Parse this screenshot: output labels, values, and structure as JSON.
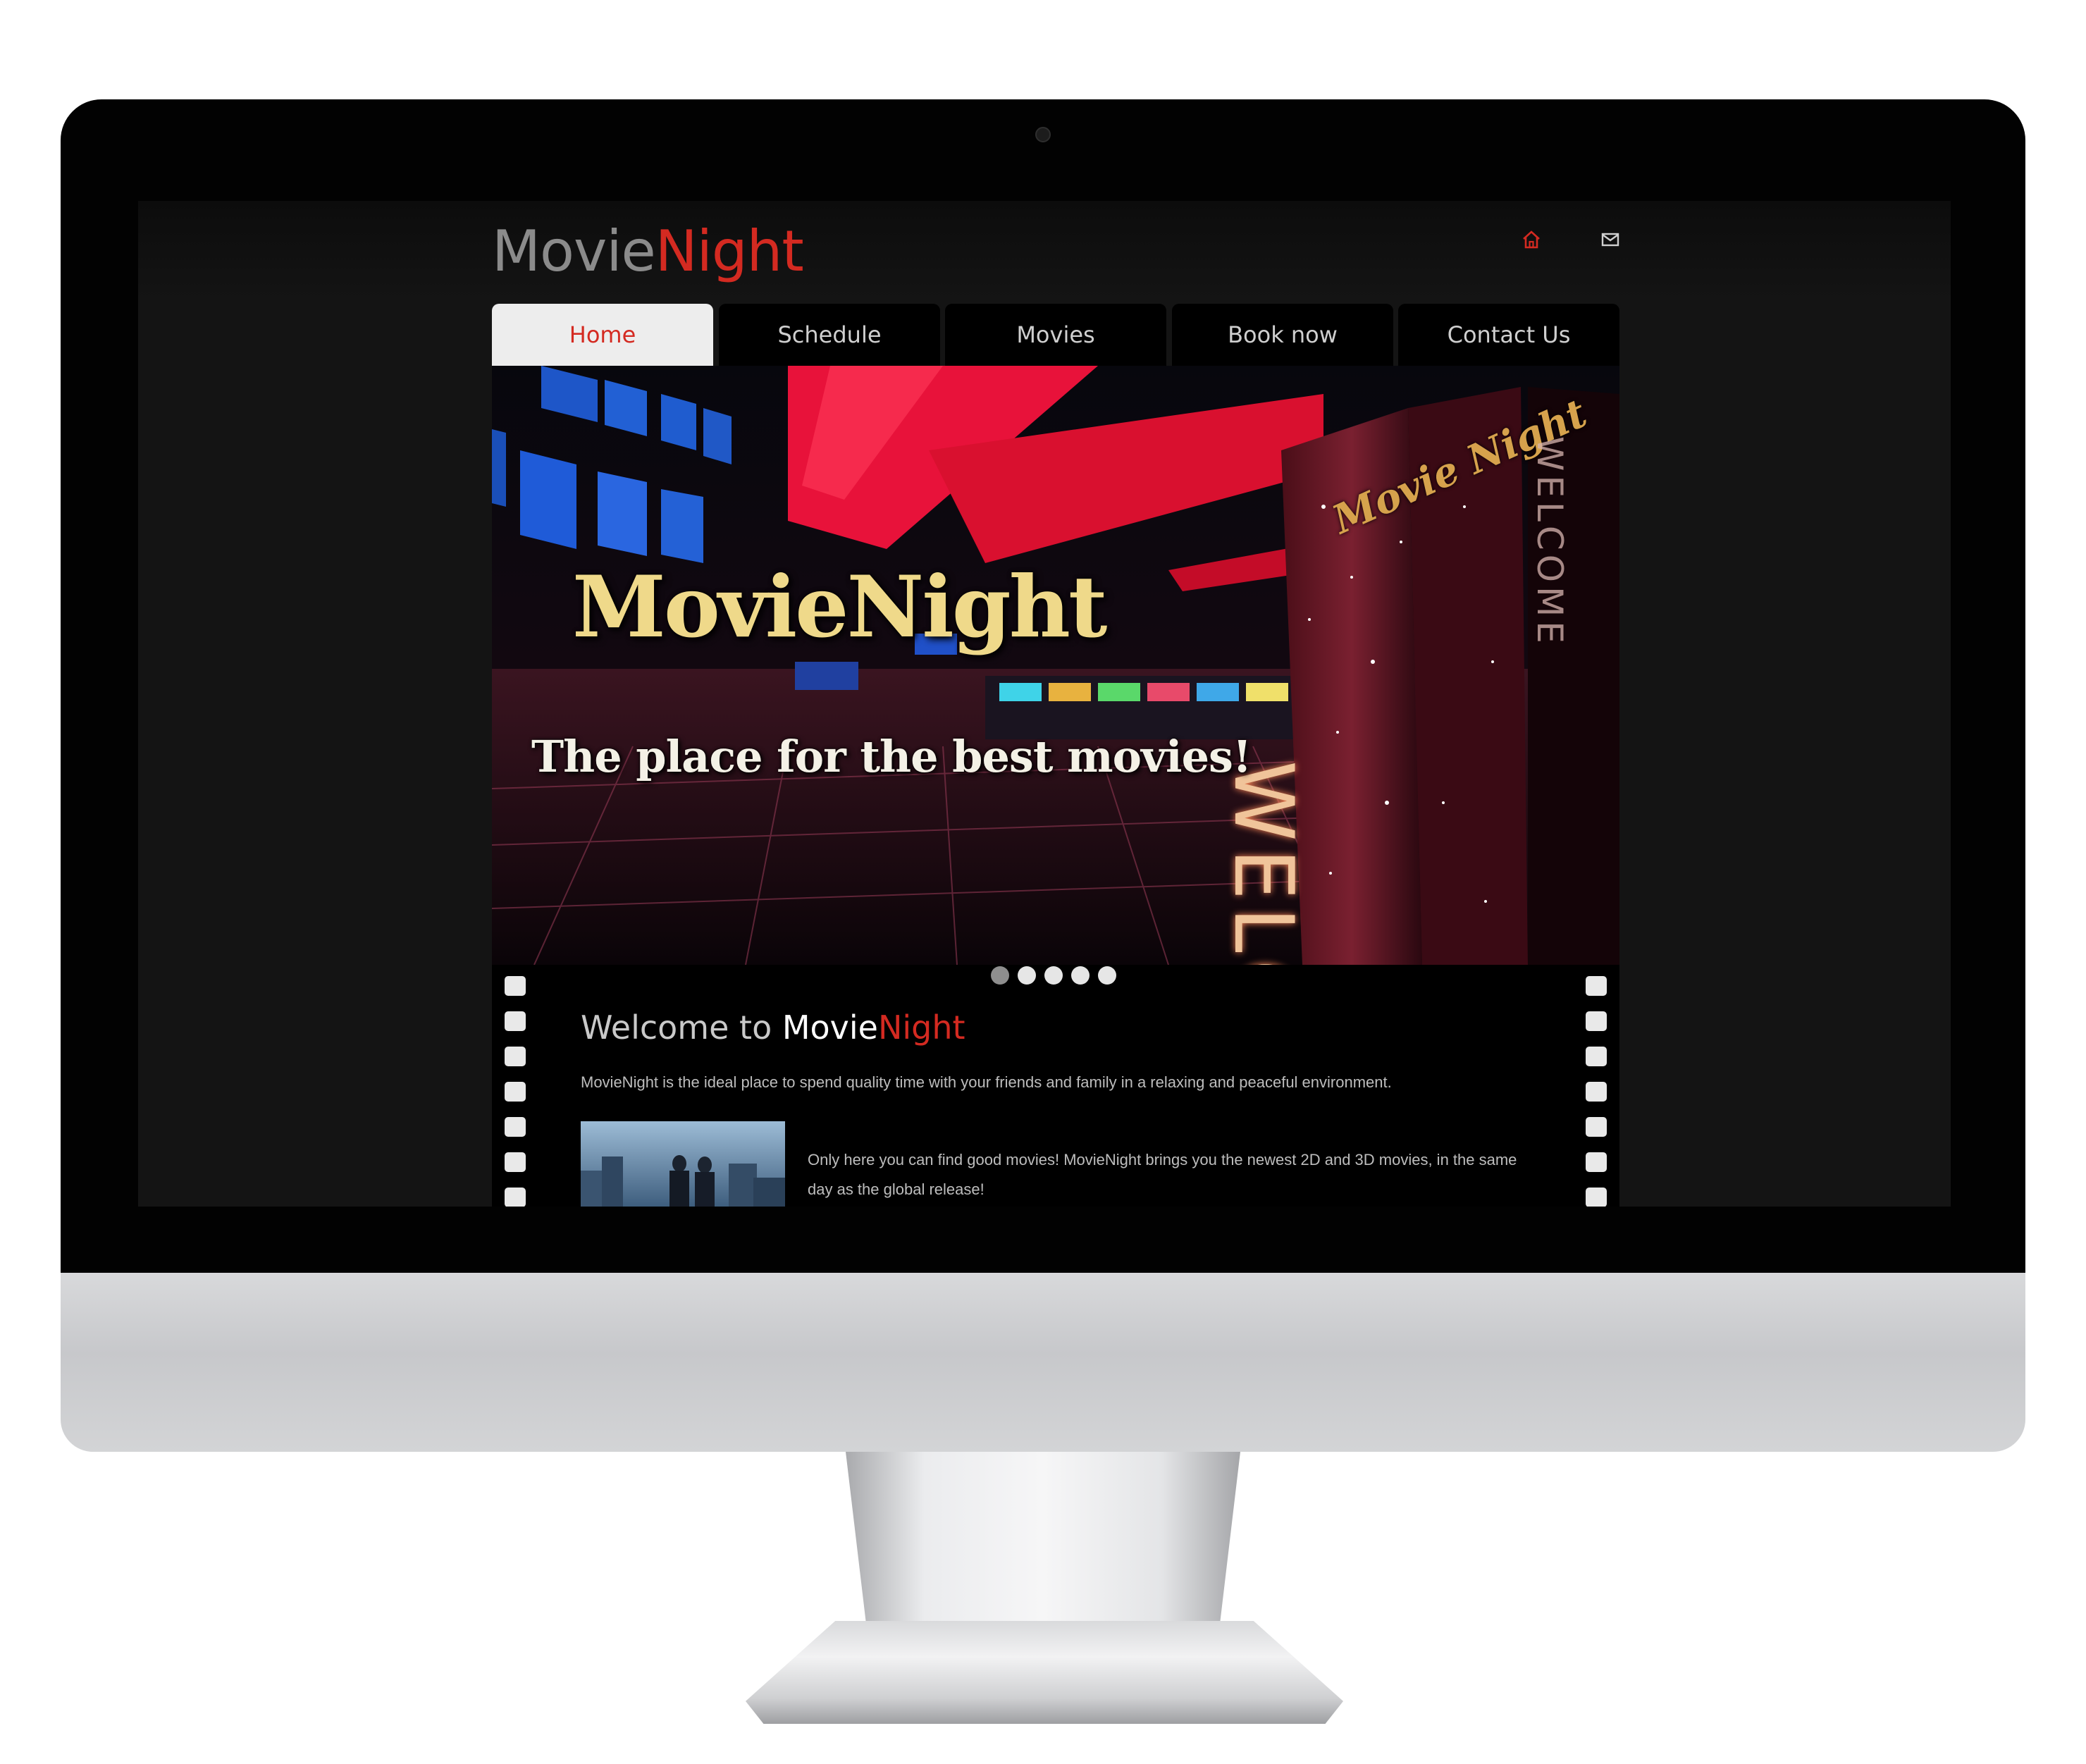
{
  "site": {
    "logo_movie": "Movie",
    "logo_night": "Night"
  },
  "header_icons": [
    "home-icon",
    "mail-icon"
  ],
  "nav": {
    "tabs": [
      {
        "label": "Home",
        "active": true
      },
      {
        "label": "Schedule",
        "active": false
      },
      {
        "label": "Movies",
        "active": false
      },
      {
        "label": "Book now",
        "active": false
      },
      {
        "label": "Contact Us",
        "active": false
      }
    ]
  },
  "hero": {
    "title": "MovieNight",
    "tagline": "The place for the best movies!",
    "sign_text": "WELCOME",
    "sign_script": "Movie Night",
    "slider_dots": 5,
    "active_dot": 0
  },
  "welcome": {
    "heading_prefix": "Welcome to ",
    "heading_movie": "Movie",
    "heading_night": "Night",
    "intro": "MovieNight is the ideal place to spend quality time with your friends and family in a relaxing and peaceful environment.",
    "movies_text": "Only here you can find good movies! MovieNight brings you the newest 2D and 3D movies, in the same day as the global release!"
  },
  "colors": {
    "accent": "#d42a21",
    "logo_gray": "#8b8b8b",
    "page_bg": "#141414",
    "hero_title": "#efd98a"
  }
}
